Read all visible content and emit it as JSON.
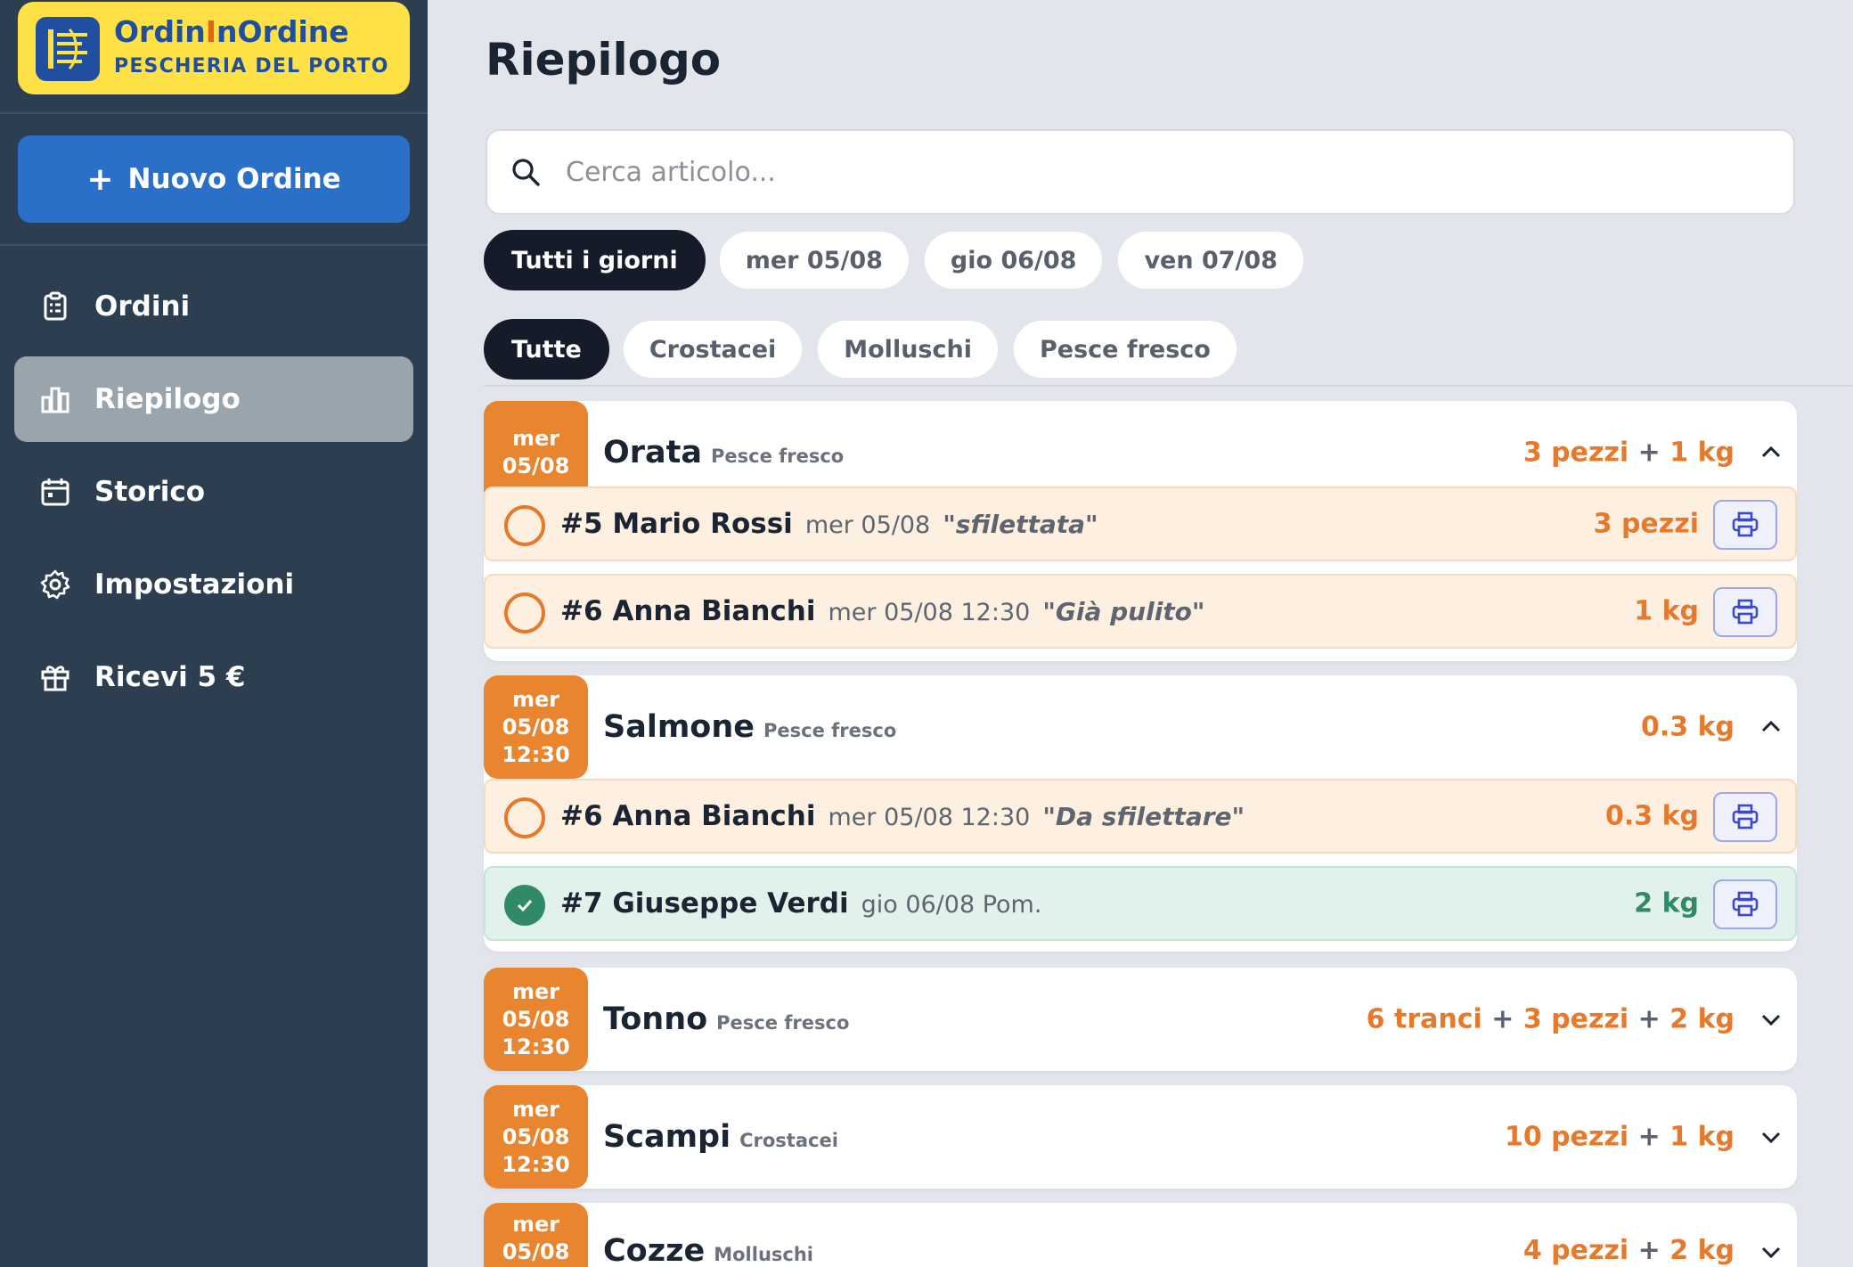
{
  "brand": {
    "title_part1": "Ordin",
    "title_accent": "I",
    "title_part2": "nOrdine",
    "subtitle": "PESCHERIA DEL PORTO"
  },
  "sidebar": {
    "new_order_icon": "+",
    "new_order_label": "Nuovo Ordine",
    "items": [
      {
        "label": "Ordini",
        "icon": "clipboard-icon"
      },
      {
        "label": "Riepilogo",
        "icon": "bar-chart-icon",
        "active": true
      },
      {
        "label": "Storico",
        "icon": "calendar-icon"
      },
      {
        "label": "Impostazioni",
        "icon": "gear-icon"
      },
      {
        "label": "Ricevi 5 €",
        "icon": "gift-icon"
      }
    ]
  },
  "page": {
    "title": "Riepilogo"
  },
  "search": {
    "placeholder": "Cerca articolo...",
    "value": ""
  },
  "day_filters": [
    "Tutti i giorni",
    "mer 05/08",
    "gio 06/08",
    "ven 07/08"
  ],
  "category_filters": [
    "Tutte",
    "Crostacei",
    "Molluschi",
    "Pesce fresco"
  ],
  "colors": {
    "accent_orange": "#e8852e",
    "done_green": "#2f8a65",
    "sidebar_bg": "#2c3e50",
    "brand_yellow": "#fde146",
    "primary_blue": "#2a70c9"
  },
  "products": [
    {
      "badge": [
        "mer",
        "05/08"
      ],
      "name": "Orata",
      "category": "Pesce fresco",
      "total": [
        "3 pezzi",
        "+",
        "1 kg"
      ],
      "expanded": true,
      "orders": [
        {
          "who": "#5 Mario Rossi",
          "when": "mer 05/08",
          "note": "\"sfilettata\"",
          "qty": "3 pezzi",
          "done": false
        },
        {
          "who": "#6 Anna Bianchi",
          "when": "mer 05/08 12:30",
          "note": "\"Già pulito\"",
          "qty": "1 kg",
          "done": false
        }
      ]
    },
    {
      "badge": [
        "mer",
        "05/08",
        "12:30"
      ],
      "name": "Salmone",
      "category": "Pesce fresco",
      "total": [
        "0.3 kg"
      ],
      "expanded": true,
      "orders": [
        {
          "who": "#6 Anna Bianchi",
          "when": "mer 05/08 12:30",
          "note": "\"Da sfilettare\"",
          "qty": "0.3 kg",
          "done": false
        },
        {
          "who": "#7 Giuseppe Verdi",
          "when": "gio 06/08 Pom.",
          "note": "",
          "qty": "2 kg",
          "done": true
        }
      ]
    },
    {
      "badge": [
        "mer",
        "05/08",
        "12:30"
      ],
      "name": "Tonno",
      "category": "Pesce fresco",
      "total": [
        "6 tranci",
        "+",
        "3 pezzi",
        "+",
        "2 kg"
      ],
      "expanded": false,
      "orders": []
    },
    {
      "badge": [
        "mer",
        "05/08",
        "12:30"
      ],
      "name": "Scampi",
      "category": "Crostacei",
      "total": [
        "10 pezzi",
        "+",
        "1 kg"
      ],
      "expanded": false,
      "orders": []
    },
    {
      "badge": [
        "mer",
        "05/08"
      ],
      "name": "Cozze",
      "category": "Molluschi",
      "total": [
        "4 pezzi",
        "+",
        "2 kg"
      ],
      "expanded": false,
      "orders": []
    }
  ]
}
